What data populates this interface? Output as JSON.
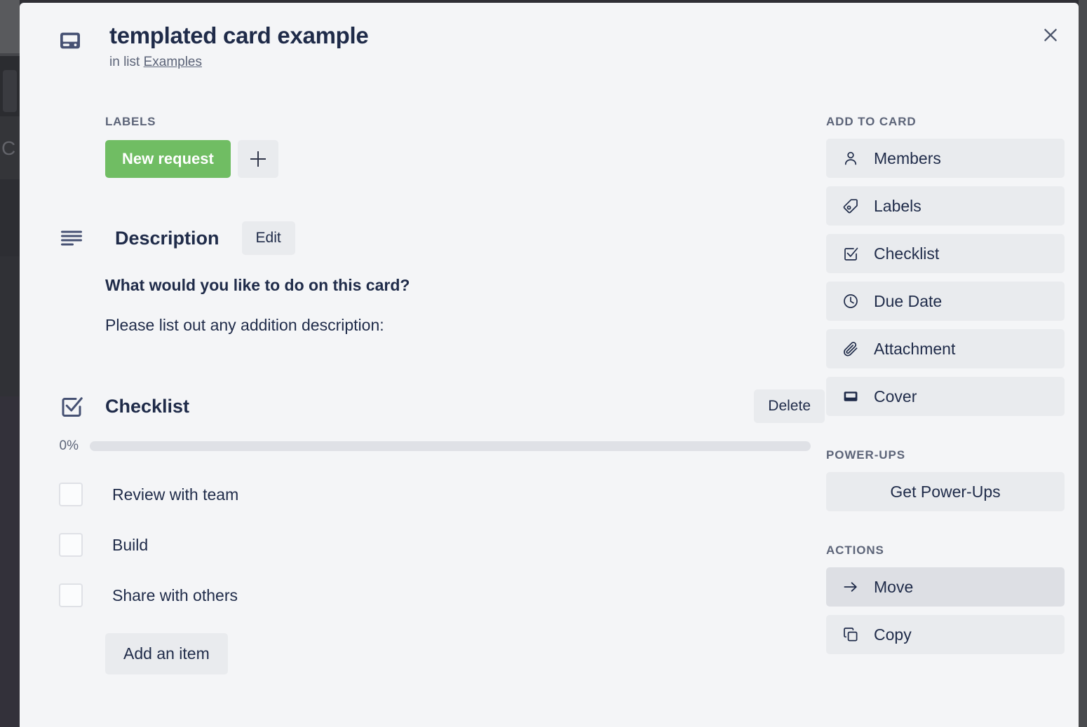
{
  "backdrop": {
    "letter": "C"
  },
  "header": {
    "close_label": "Close",
    "card_icon": "card-icon",
    "title": "templated card example",
    "in_list_prefix": "in list",
    "list_name": "Examples"
  },
  "labels": {
    "heading": "LABELS",
    "items": [
      {
        "text": "New request",
        "color": "#70bd63"
      }
    ],
    "add_label": "+"
  },
  "description": {
    "heading": "Description",
    "edit_label": "Edit",
    "question": "What would you like to do on this card?",
    "prompt": "Please list out any addition description:"
  },
  "checklist": {
    "heading": "Checklist",
    "delete_label": "Delete",
    "progress_percent_text": "0%",
    "progress_percent": 0,
    "items": [
      {
        "text": "Review with team",
        "checked": false
      },
      {
        "text": "Build",
        "checked": false
      },
      {
        "text": "Share with others",
        "checked": false
      }
    ],
    "add_item_label": "Add an item"
  },
  "sidebar": {
    "add_to_card_heading": "ADD TO CARD",
    "add_to_card_items": [
      {
        "label": "Members",
        "icon": "person-icon"
      },
      {
        "label": "Labels",
        "icon": "tag-icon"
      },
      {
        "label": "Checklist",
        "icon": "checkbox-check-icon"
      },
      {
        "label": "Due Date",
        "icon": "clock-icon"
      },
      {
        "label": "Attachment",
        "icon": "paperclip-icon"
      },
      {
        "label": "Cover",
        "icon": "cover-icon"
      }
    ],
    "power_ups_heading": "POWER-UPS",
    "power_ups_items": [
      {
        "label": "Get Power-Ups",
        "icon": "none"
      }
    ],
    "actions_heading": "ACTIONS",
    "actions_items": [
      {
        "label": "Move",
        "icon": "arrow-right-icon",
        "active": true
      },
      {
        "label": "Copy",
        "icon": "copy-icon",
        "active": false
      }
    ]
  },
  "colors": {
    "modal_bg": "#f4f5f7",
    "button_bg": "#e9ebee",
    "button_bg_active": "#dddfe4",
    "text_primary": "#1f2b49",
    "text_muted": "#5c6478",
    "label_green": "#70bd63",
    "track_grey": "#dfe1e6"
  }
}
